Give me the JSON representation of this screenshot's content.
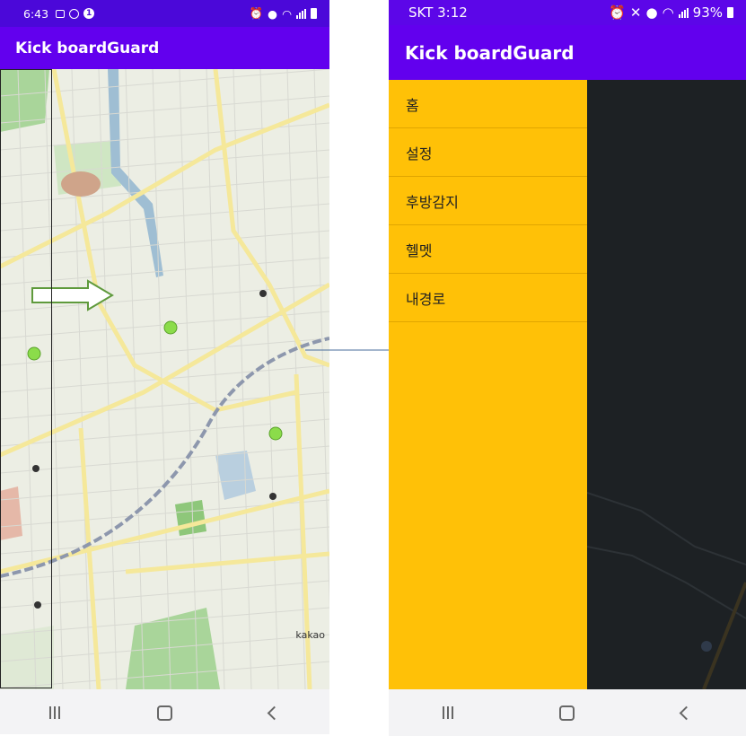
{
  "left_phone": {
    "status": {
      "time": "6:43"
    },
    "app_title": "Kick boardGuard",
    "map_attribution": "kakao"
  },
  "right_phone": {
    "status": {
      "time": "SKT 3:12",
      "battery": "93%"
    },
    "app_title": "Kick boardGuard",
    "drawer": {
      "items": [
        {
          "label": "홈"
        },
        {
          "label": "설정"
        },
        {
          "label": "후방감지"
        },
        {
          "label": "헬멧"
        },
        {
          "label": "내경로"
        }
      ]
    }
  },
  "colors": {
    "status_bar": "#4b08d9",
    "app_bar": "#6200ee",
    "drawer": "#ffc107",
    "scrim": "#1d2124",
    "map_marker": "#8bdc4a"
  }
}
